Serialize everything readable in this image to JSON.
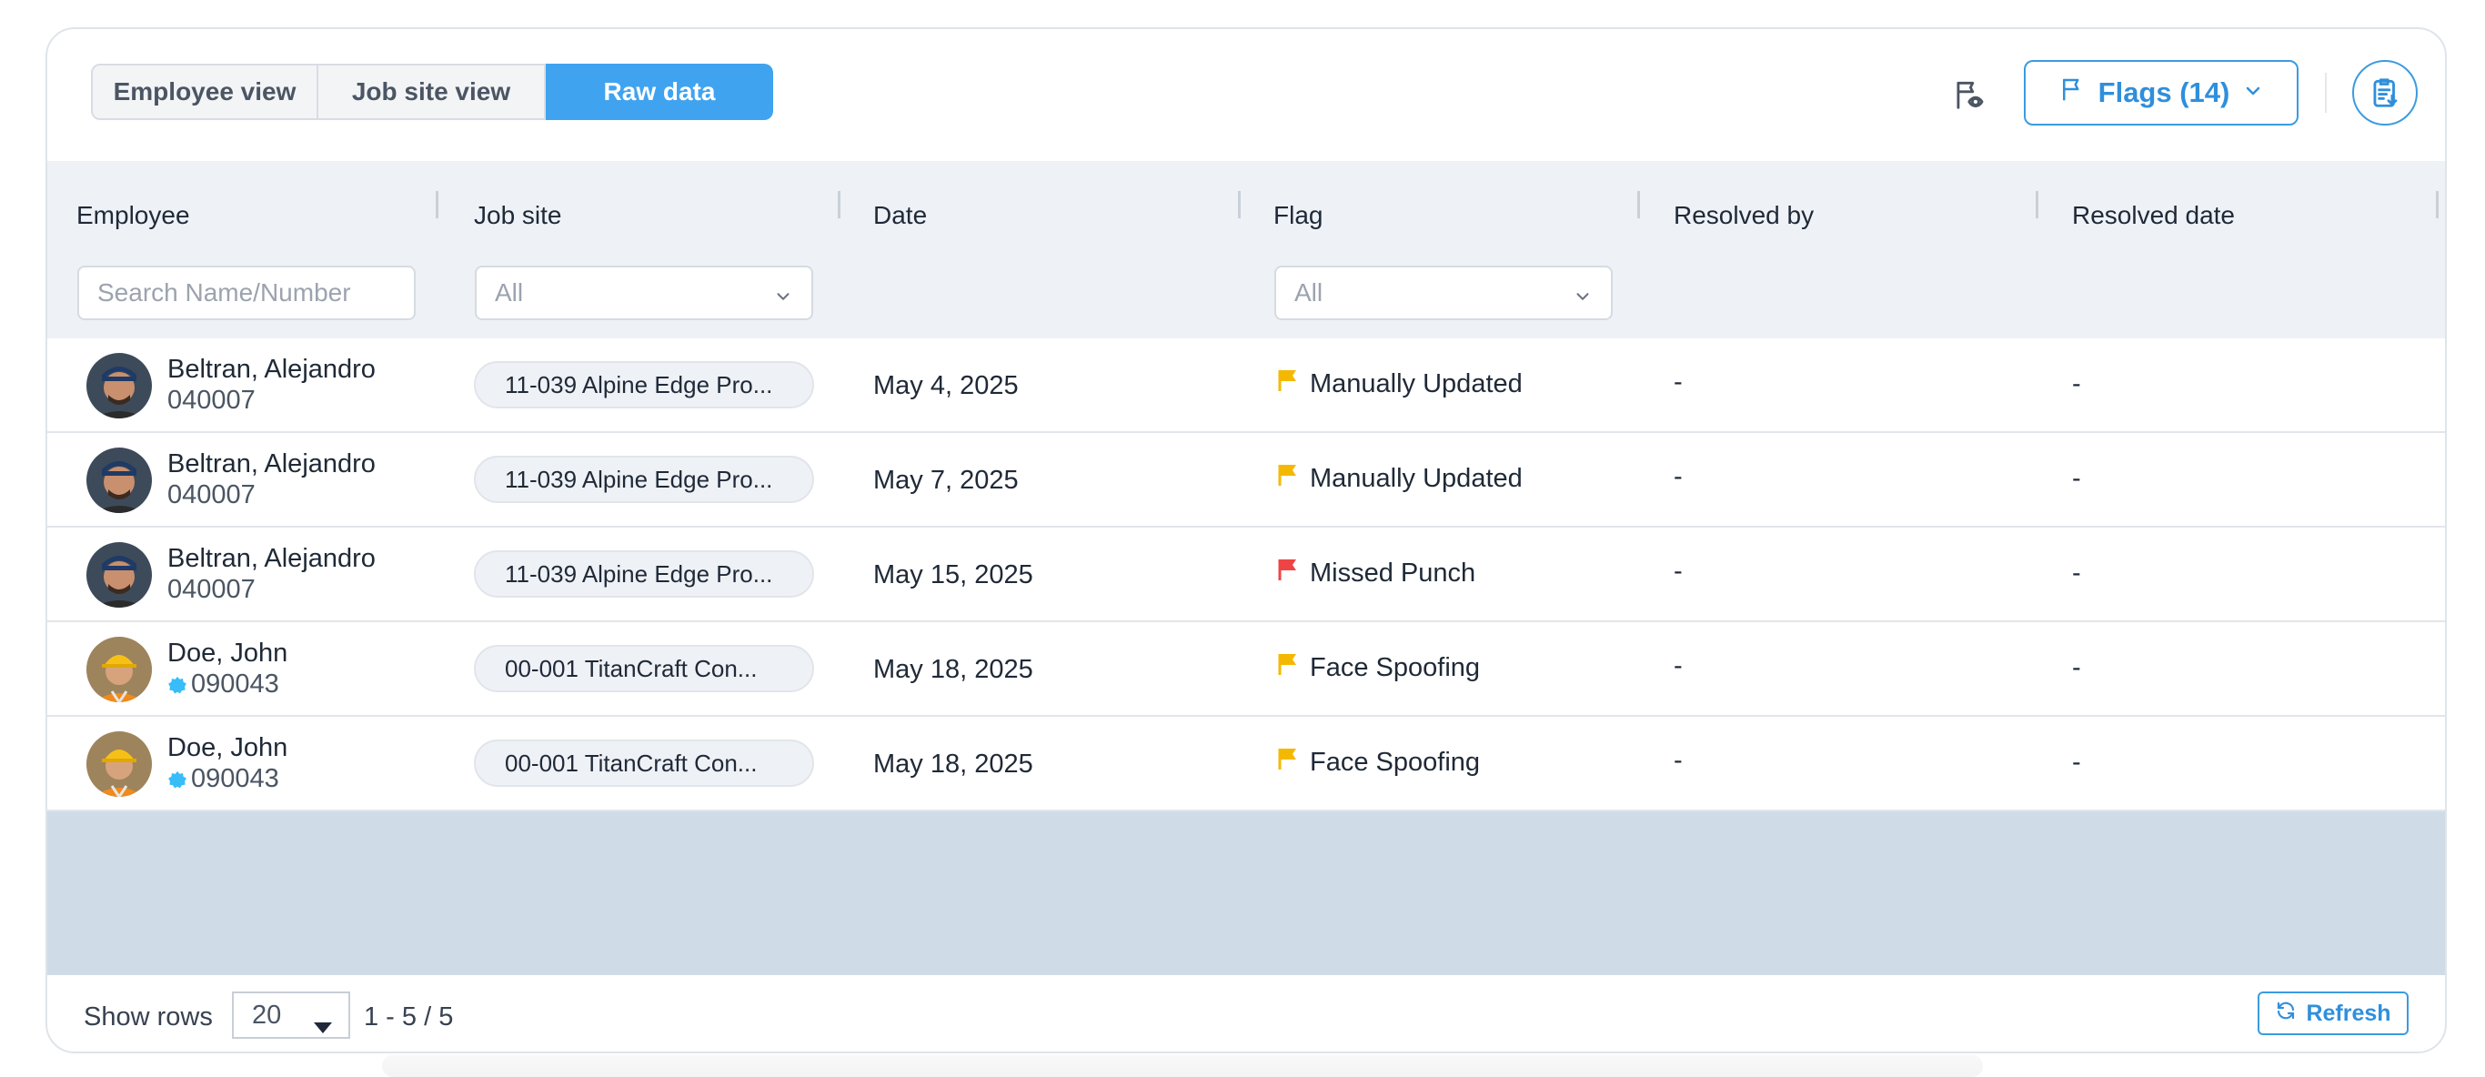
{
  "toolbar": {
    "tabs": [
      {
        "label": "Employee view",
        "active": false
      },
      {
        "label": "Job site view",
        "active": false
      },
      {
        "label": "Raw data",
        "active": true
      }
    ],
    "flags_button_label": "Flags (14)",
    "accent_color": "#3fa3f0",
    "icons": [
      "flag-eye-icon",
      "flag-icon",
      "chevron-down-icon",
      "clipboard-export-icon"
    ]
  },
  "table": {
    "columns": [
      "Employee",
      "Job site",
      "Date",
      "Flag",
      "Resolved by",
      "Resolved date"
    ],
    "filters": {
      "employee_placeholder": "Search Name/Number",
      "job_site_value": "All",
      "flag_value": "All"
    },
    "rows": [
      {
        "name": "Beltran, Alejandro",
        "number": "040007",
        "verified": false,
        "job_site": "11-039 Alpine Edge Pro...",
        "date": "May 4, 2025",
        "flag": "Manually Updated",
        "flag_color": "#f5b800",
        "resolved_by": "-",
        "resolved_date": "-"
      },
      {
        "name": "Beltran, Alejandro",
        "number": "040007",
        "verified": false,
        "job_site": "11-039 Alpine Edge Pro...",
        "date": "May 7, 2025",
        "flag": "Manually Updated",
        "flag_color": "#f5b800",
        "resolved_by": "-",
        "resolved_date": "-"
      },
      {
        "name": "Beltran, Alejandro",
        "number": "040007",
        "verified": false,
        "job_site": "11-039 Alpine Edge Pro...",
        "date": "May 15, 2025",
        "flag": "Missed Punch",
        "flag_color": "#ef4444",
        "resolved_by": "-",
        "resolved_date": "-"
      },
      {
        "name": "Doe, John",
        "number": "090043",
        "verified": true,
        "job_site": "00-001 TitanCraft Con...",
        "date": "May 18, 2025",
        "flag": "Face Spoofing",
        "flag_color": "#f5b800",
        "resolved_by": "-",
        "resolved_date": "-"
      },
      {
        "name": "Doe, John",
        "number": "090043",
        "verified": true,
        "job_site": "00-001 TitanCraft Con...",
        "date": "May 18, 2025",
        "flag": "Face Spoofing",
        "flag_color": "#f5b800",
        "resolved_by": "-",
        "resolved_date": "-"
      }
    ]
  },
  "footer": {
    "show_rows_label": "Show rows",
    "rows_per_page": "20",
    "range_text": "1 - 5 / 5",
    "refresh_label": "Refresh"
  }
}
